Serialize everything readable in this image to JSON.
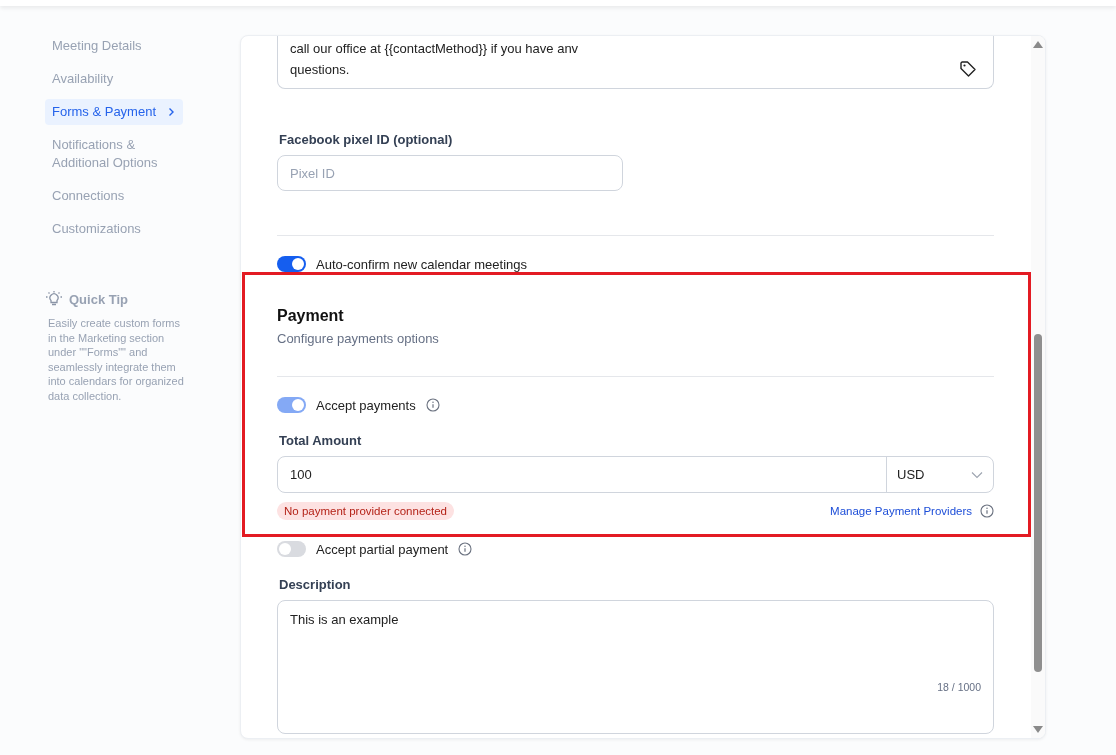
{
  "sidebar": {
    "items": [
      {
        "label": "Meeting Details",
        "selected": false
      },
      {
        "label": "Availability",
        "selected": false
      },
      {
        "label": "Forms & Payment",
        "selected": true
      },
      {
        "label": "Notifications & Additional Options",
        "selected": false
      },
      {
        "label": "Connections",
        "selected": false
      },
      {
        "label": "Customizations",
        "selected": false
      }
    ],
    "quick_tip": {
      "title": "Quick Tip",
      "text": "Easily create custom forms in the Marketing section under \"\"Forms\"\" and seamlessly integrate them into calendars for organized data collection."
    }
  },
  "form": {
    "message_field": {
      "value": "call our office at {{contactMethod}} if you have anv\nquestions."
    },
    "pixel_field": {
      "label": "Facebook pixel ID (optional)",
      "placeholder": "Pixel ID"
    },
    "auto_confirm": {
      "label": "Auto-confirm new calendar meetings",
      "on": true,
      "disabled": false
    },
    "payment": {
      "title": "Payment",
      "subtitle": "Configure payments options",
      "accept_payments": {
        "label": "Accept payments",
        "on": true,
        "disabled": true
      },
      "total_amount": {
        "label": "Total Amount",
        "value": "100",
        "currency": "USD"
      },
      "error_badge": "No payment provider connected",
      "manage_link": "Manage Payment Providers",
      "highlighted": true
    },
    "accept_partial": {
      "label": "Accept partial payment",
      "on": false,
      "disabled": false
    },
    "description": {
      "label": "Description",
      "value": "This is an example",
      "counter": "18 / 1000"
    }
  }
}
